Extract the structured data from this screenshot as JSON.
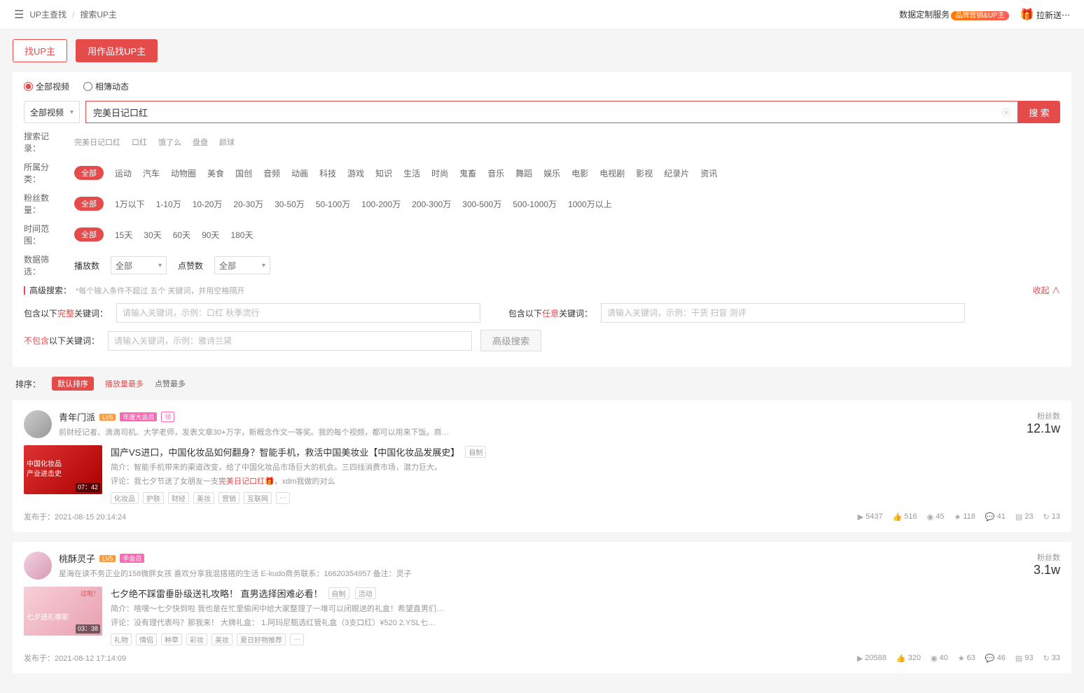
{
  "breadcrumb": {
    "level1": "UP主查找",
    "level2": "搜索UP主"
  },
  "topRight": {
    "customData": "数据定制服务",
    "badge": "品牌营销&UP主",
    "laxin": "拉新送⋯"
  },
  "tabs": {
    "findUp": "找UP主",
    "findByWork": "用作品找UP主"
  },
  "radio": {
    "allVideo": "全部视频",
    "dynamic": "相簿动态"
  },
  "search": {
    "typeLabel": "全部视频",
    "query": "完美日记口红",
    "btn": "搜 索"
  },
  "history": {
    "label": "搜索记录：",
    "items": [
      "完美日记口红",
      "口红",
      "饿了么",
      "盘盘",
      "颜球"
    ]
  },
  "category": {
    "label": "所属分类：",
    "all": "全部",
    "items": [
      "运动",
      "汽车",
      "动物圈",
      "美食",
      "国创",
      "音频",
      "动画",
      "科技",
      "游戏",
      "知识",
      "生活",
      "时尚",
      "鬼畜",
      "音乐",
      "舞蹈",
      "娱乐",
      "电影",
      "电视剧",
      "影视",
      "纪录片",
      "资讯"
    ]
  },
  "fans": {
    "label": "粉丝数量：",
    "all": "全部",
    "items": [
      "1万以下",
      "1-10万",
      "10-20万",
      "20-30万",
      "30-50万",
      "50-100万",
      "100-200万",
      "200-300万",
      "300-500万",
      "500-1000万",
      "1000万以上"
    ]
  },
  "timeRange": {
    "label": "时间范围：",
    "all": "全部",
    "items": [
      "15天",
      "30天",
      "60天",
      "90天",
      "180天"
    ]
  },
  "dataFilter": {
    "label": "数据筛选：",
    "playLabel": "播放数",
    "playAll": "全部",
    "likeLabel": "点赞数",
    "likeAll": "全部"
  },
  "adv": {
    "title": "高级搜索：",
    "hint": "*每个输入条件不超过 五个 关键词，并用空格隔开",
    "collapse": "收起 ∧",
    "row1Label_pre": "包含以下",
    "row1Label_hl": "完整",
    "row1Label_post": "关键词：",
    "row1Placeholder": "请输入关键词，示例：口红 秋季流行",
    "row2Label_pre": "包含以下",
    "row2Label_hl": "任意",
    "row2Label_post": "关键词：",
    "row2Placeholder": "请输入关键词，示例：干货 扫盲 测评",
    "row3Label_pre_hl": "不包含",
    "row3Label_post": "以下关键词：",
    "row3Placeholder": "请输入关键词，示例：雅诗兰黛",
    "btn": "高级搜索"
  },
  "sort": {
    "label": "排序：",
    "default": "默认排序",
    "playMost": "播放量最多",
    "likeMost": "点赞最多"
  },
  "results": [
    {
      "name": "青年门派",
      "lv": "LV6",
      "member": "年度大会员",
      "follow": "领",
      "desc": "前财经记者、滴滴司机、大学老师，发表文章30+万字，新概念作文一等奖。我的每个视频，都可以用来下饭。商…",
      "fansLabel": "粉丝数",
      "fans": "12.1w",
      "thumbTitle1": "中国化妆品",
      "thumbTitle2": "产业进击史",
      "duration": "07：42",
      "videoTitle": "国产VS进口，中国化妆品如何翻身？智能手机，救活中国美妆业【中国化妆品发展史】",
      "miniTag": "自制",
      "intro_label": "简介：",
      "intro": "智能手机带来的渠道改变，给了中国化妆品市场巨大的机会。三四线消费市场，潜力巨大。",
      "comment_label": "评论：",
      "comment_pre": "我七夕节送了女朋友一支",
      "comment_hl": "完美日记口红🎁",
      "comment_post": "，xdm我做的对么",
      "tags": [
        "化妆品",
        "护肤",
        "财经",
        "美妆",
        "营销",
        "互联网",
        "…"
      ],
      "postedLabel": "发布于：",
      "postedAt": "2021-08-15 20:14:24",
      "stats": {
        "play": "5437",
        "like": "516",
        "coin": "45",
        "fav": "118",
        "comment": "41",
        "danmu": "23",
        "share": "13"
      }
    },
    {
      "name": "桃酥灵子",
      "lv": "LV5",
      "member": "手会员",
      "follow": "",
      "desc": "星海在读不务正业的158微胖女孩 喜欢分享我混搭搭的生活 E-kudo商务联系：16620354957 备注：灵子",
      "fansLabel": "粉丝数",
      "fans": "3.1w",
      "thumbTitle1": "",
      "thumbTitle2": "七夕送礼哪家",
      "duration": "03：38",
      "overlayTag": "过啦！",
      "videoTitle": "七夕绝不踩雷垂卧级送礼攻略！ 直男选择困难必看！",
      "miniTag": "自制",
      "miniTag2": "活动",
      "intro_label": "简介：",
      "intro": "啥嘿～七夕快到啦 我也是在忙里偷闲中给大家整理了一堆可以闭眼送的礼盒！希望直男们…",
      "comment_label": "评论：",
      "comment": "没有理代表吗？那我来！ 大牌礼盒： 1.阿玛尼甄选红管礼盒（3支口红）¥520 2.YSL七…",
      "tags": [
        "礼物",
        "情侣",
        "种草",
        "彩妆",
        "美妆",
        "夏日好物推荐",
        "…"
      ],
      "postedLabel": "发布于：",
      "postedAt": "2021-08-12 17:14:09",
      "stats": {
        "play": "20588",
        "like": "320",
        "coin": "40",
        "fav": "63",
        "comment": "46",
        "danmu": "93",
        "share": "33"
      }
    }
  ]
}
